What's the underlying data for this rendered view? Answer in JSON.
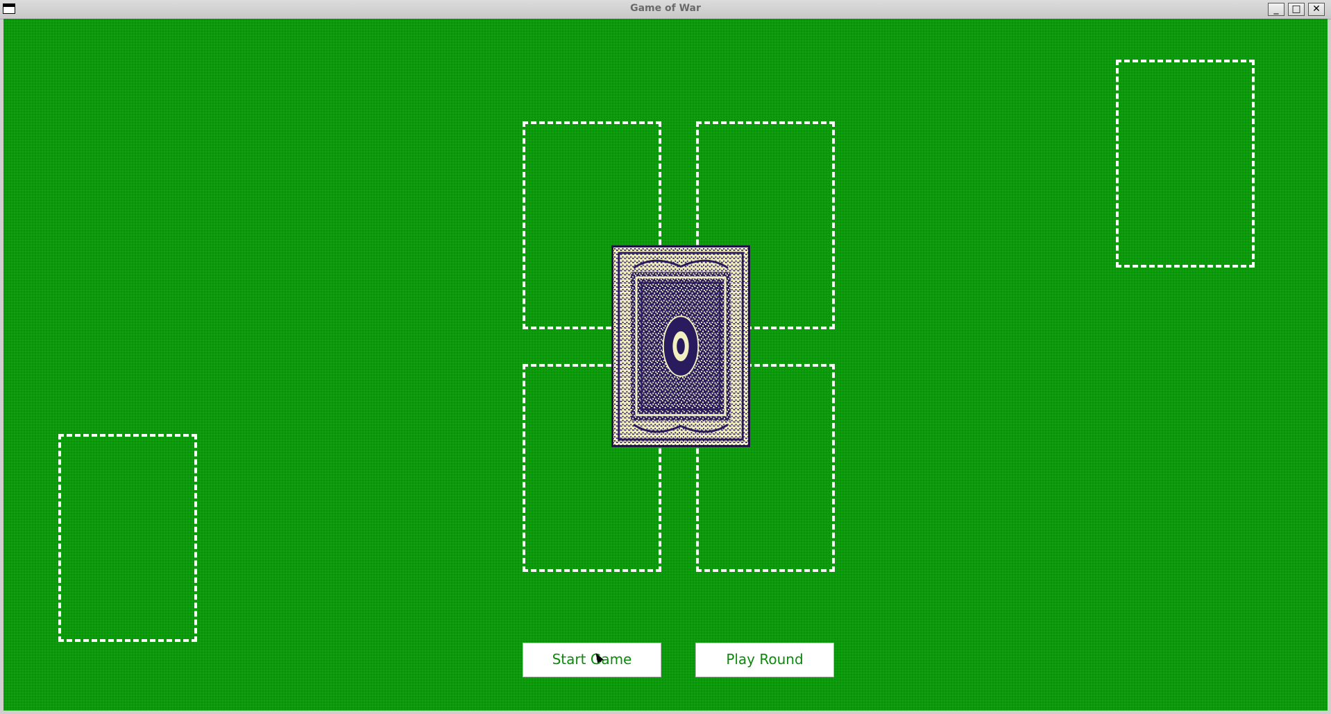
{
  "window": {
    "title": "Game of War",
    "minimize_label": "_",
    "maximize_label": "□",
    "close_label": "✕"
  },
  "table": {
    "background_color": "#0a9a0a",
    "slot_border_color": "#ffffff",
    "card_back_colors": [
      "#2a1a5e",
      "#f2f0c0"
    ]
  },
  "controls": {
    "start_label": "Start Game",
    "play_label": "Play Round"
  },
  "icons": {
    "system_menu": "window-menu-icon",
    "minimize": "minimize-icon",
    "maximize": "maximize-icon",
    "close": "close-icon"
  }
}
